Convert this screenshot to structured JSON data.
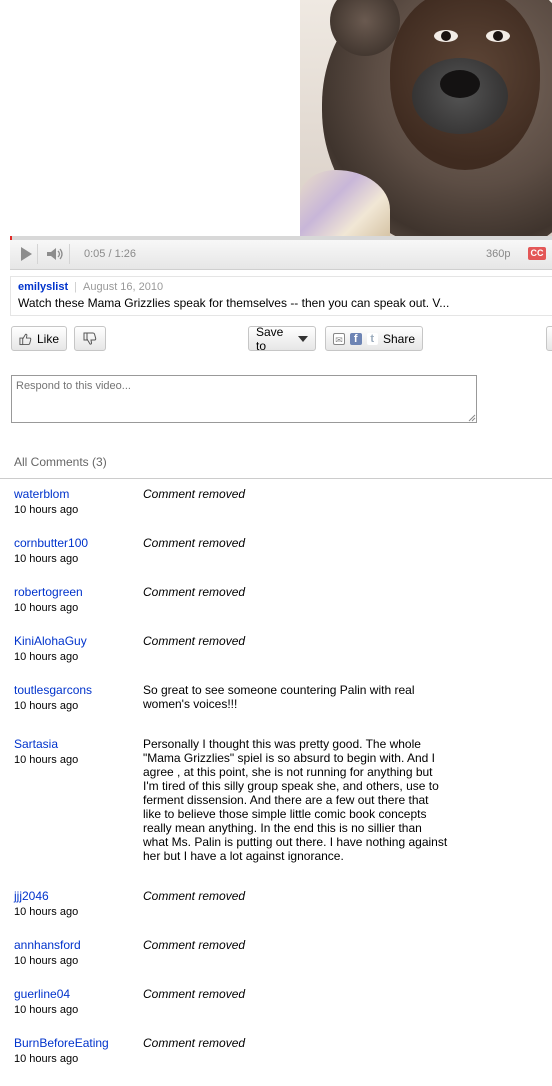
{
  "player": {
    "progress": 0.004,
    "time": "0:05 / 1:26",
    "quality": "360p",
    "cc_label": "CC"
  },
  "video_info": {
    "uploader": "emilyslist",
    "date": "August 16, 2010",
    "description": "Watch these Mama Grizzlies speak for themselves -- then you can speak out. V..."
  },
  "actions": {
    "like_label": "Like",
    "save_label": "Save to",
    "share_label": "Share"
  },
  "respond": {
    "placeholder": "Respond to this video..."
  },
  "comments": {
    "header": "All Comments (3)",
    "items": [
      {
        "user": "waterblom",
        "time": "10 hours ago",
        "text": "Comment removed",
        "removed": true
      },
      {
        "user": "cornbutter100",
        "time": "10 hours ago",
        "text": "Comment removed",
        "removed": true
      },
      {
        "user": "robertogreen",
        "time": "10 hours ago",
        "text": "Comment removed",
        "removed": true
      },
      {
        "user": "KiniAlohaGuy",
        "time": "10 hours ago",
        "text": "Comment removed",
        "removed": true
      },
      {
        "user": "toutlesgarcons",
        "time": "10 hours ago",
        "text": "So great to see someone countering Palin with real women's voices!!!",
        "removed": false
      },
      {
        "user": "Sartasia",
        "time": "10 hours ago",
        "text": "Personally I thought this was pretty good. The whole \"Mama Grizzlies\" spiel is so absurd to begin with. And I agree , at this point, she is not running for anything but I'm tired of this silly group speak she, and others, use to ferment dissension. And there are a few out there that like to believe those simple little comic book concepts really mean anything. In the end this is no sillier than what Ms. Palin is putting out there. I have nothing against her but I have a lot against ignorance.",
        "removed": false
      },
      {
        "user": "jjj2046",
        "time": "10 hours ago",
        "text": "Comment removed",
        "removed": true
      },
      {
        "user": "annhansford",
        "time": "10 hours ago",
        "text": "Comment removed",
        "removed": true
      },
      {
        "user": "guerline04",
        "time": "10 hours ago",
        "text": "Comment removed",
        "removed": true
      },
      {
        "user": "BurnBeforeEating",
        "time": "10 hours ago",
        "text": "Comment removed",
        "removed": true
      }
    ]
  }
}
